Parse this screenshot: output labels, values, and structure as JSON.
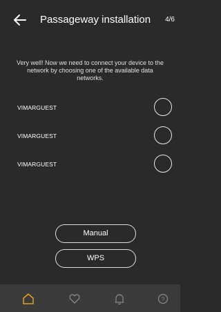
{
  "header": {
    "back_icon": "arrow-left-icon",
    "title": "Passageway installation",
    "step": "4/6"
  },
  "instruction": "Very well! Now we need to connect your device to the network by choosing one of the available data networks.",
  "networks": [
    {
      "name": "VIMARGUEST"
    },
    {
      "name": "VIMARGUEST"
    },
    {
      "name": "VIMARGUEST"
    }
  ],
  "buttons": {
    "manual_label": "Manual",
    "wps_label": "WPS"
  },
  "tabbar": {
    "active_color": "#e8a020",
    "inactive_color": "#8a8a8a",
    "tabs": [
      {
        "icon": "home-icon",
        "active": true
      },
      {
        "icon": "heart-icon",
        "active": false
      },
      {
        "icon": "bell-icon",
        "active": false
      },
      {
        "icon": "help-icon",
        "active": false
      }
    ]
  }
}
